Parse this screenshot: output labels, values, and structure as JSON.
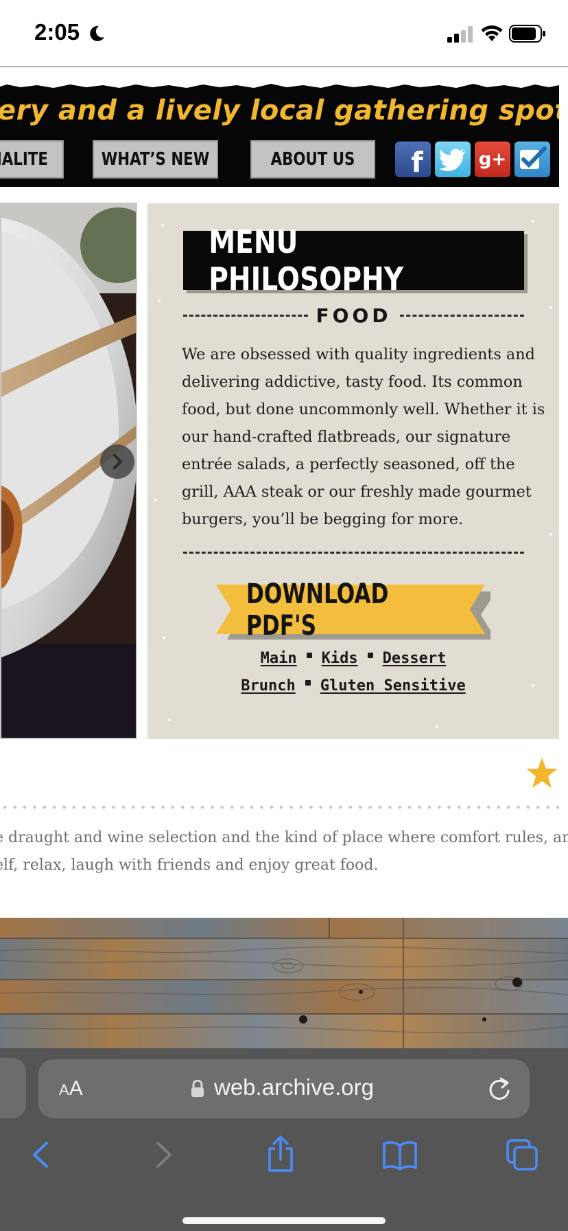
{
  "status_bar": {
    "time": "2:05"
  },
  "site_header": {
    "tagline": "ery and a lively local gathering spot!”",
    "nav": {
      "socialite": "CIALITE",
      "whats_new": "WHAT’S NEW",
      "about_us": "ABOUT US"
    },
    "social": {
      "facebook": "f",
      "googleplus": "g+"
    }
  },
  "menu_philosophy": {
    "title": "MENU PHILOSOPHY",
    "section": "FOOD",
    "description": "We are obsessed with quality ingredients and delivering addictive, tasty food. Its common food, but done uncommonly well. Whether it is our hand-crafted flatbreads, our signature entrée salads, a perfectly seasoned, off the grill, AAA steak or our freshly made gourmet burgers, you’ll be begging for more.",
    "download_label": "DOWNLOAD PDF'S",
    "pdf_links": {
      "main": "Main",
      "kids": "Kids",
      "dessert": "Dessert",
      "brunch": "Brunch",
      "gluten_sensitive": "Gluten Sensitive"
    }
  },
  "blurb": {
    "line1": "e draught and wine selection and the kind of place where comfort rules, and",
    "line2": "elf, relax, laugh with friends and enjoy great food."
  },
  "browser": {
    "aa_small": "A",
    "aa_large": "A",
    "url": "web.archive.org"
  },
  "colors": {
    "accent_yellow": "#f2b72f",
    "menu_panel_bg": "#e2ddd2",
    "ios_blue": "#4a8df8",
    "browser_bar": "#555555"
  },
  "icons": [
    "moon-icon",
    "signal-icon",
    "wifi-icon",
    "battery-icon",
    "facebook-icon",
    "twitter-icon",
    "google-plus-icon",
    "foursquare-icon",
    "chevron-right-icon",
    "star-icon",
    "lock-icon",
    "reload-icon",
    "back-icon",
    "forward-icon",
    "share-icon",
    "bookmarks-icon",
    "tabs-icon"
  ]
}
